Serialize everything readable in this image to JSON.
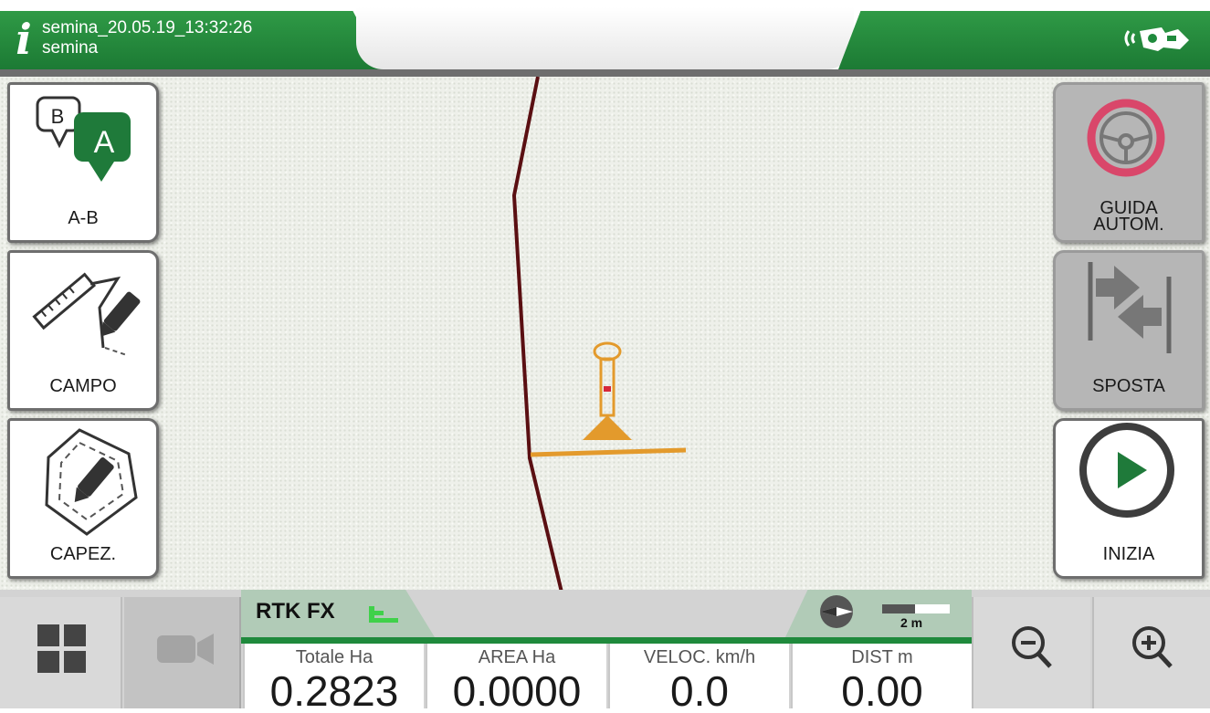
{
  "header": {
    "file_name": "semina_20.05.19_13:32:26",
    "job_type": "semina",
    "info_icon": "info-icon",
    "status_icon": "gnss-signal-icon"
  },
  "left_buttons": [
    {
      "label": "A-B",
      "icon": "ab-line-icon"
    },
    {
      "label": "CAMPO",
      "icon": "field-boundary-icon"
    },
    {
      "label": "CAPEZ.",
      "icon": "headland-icon"
    }
  ],
  "right_buttons": [
    {
      "label": "GUIDA\nAUTOM.",
      "icon": "steering-wheel-icon",
      "state": "disabled"
    },
    {
      "label": "SPOSTA",
      "icon": "shift-line-icon",
      "state": "disabled"
    },
    {
      "label": "INIZIA",
      "icon": "play-icon",
      "state": "enabled"
    }
  ],
  "bottom": {
    "gps_status": "RTK FX",
    "scale_label": "2 m",
    "readouts": [
      {
        "label": "Totale Ha",
        "value": "0.2823"
      },
      {
        "label": "AREA Ha",
        "value": "0.0000"
      },
      {
        "label": "VELOC. km/h",
        "value": "0.0"
      },
      {
        "label": "DIST m",
        "value": "0.00"
      }
    ],
    "icons": [
      "menu-grid-icon",
      "camera-icon",
      "zoom-out-icon",
      "zoom-in-icon"
    ]
  },
  "colors": {
    "header_green": "#1f8a3c",
    "accent_green": "#1f7a3a",
    "track_line": "#5a0f12",
    "implement": "#e39a2c",
    "steering_ring": "#d9476a"
  }
}
